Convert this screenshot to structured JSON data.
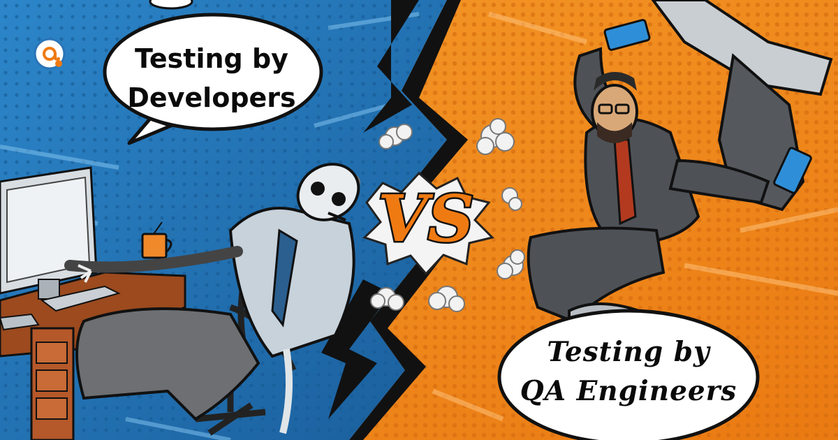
{
  "left_bubble": {
    "line1": "Testing by",
    "line2": "Developers"
  },
  "right_bubble": {
    "line1": "Testing by",
    "line2": "QA Engineers"
  },
  "versus_label": "VS",
  "logo_icon": "qa-at-sign-logo-icon",
  "colors": {
    "left_background": "#1f6fb4",
    "right_background": "#f08a1e",
    "lightning": "#111111",
    "bubble_fill": "#ffffff",
    "vs_letters": "#f07a12",
    "logo_ring": "#2a74b8",
    "logo_dot": "#f07a12"
  }
}
